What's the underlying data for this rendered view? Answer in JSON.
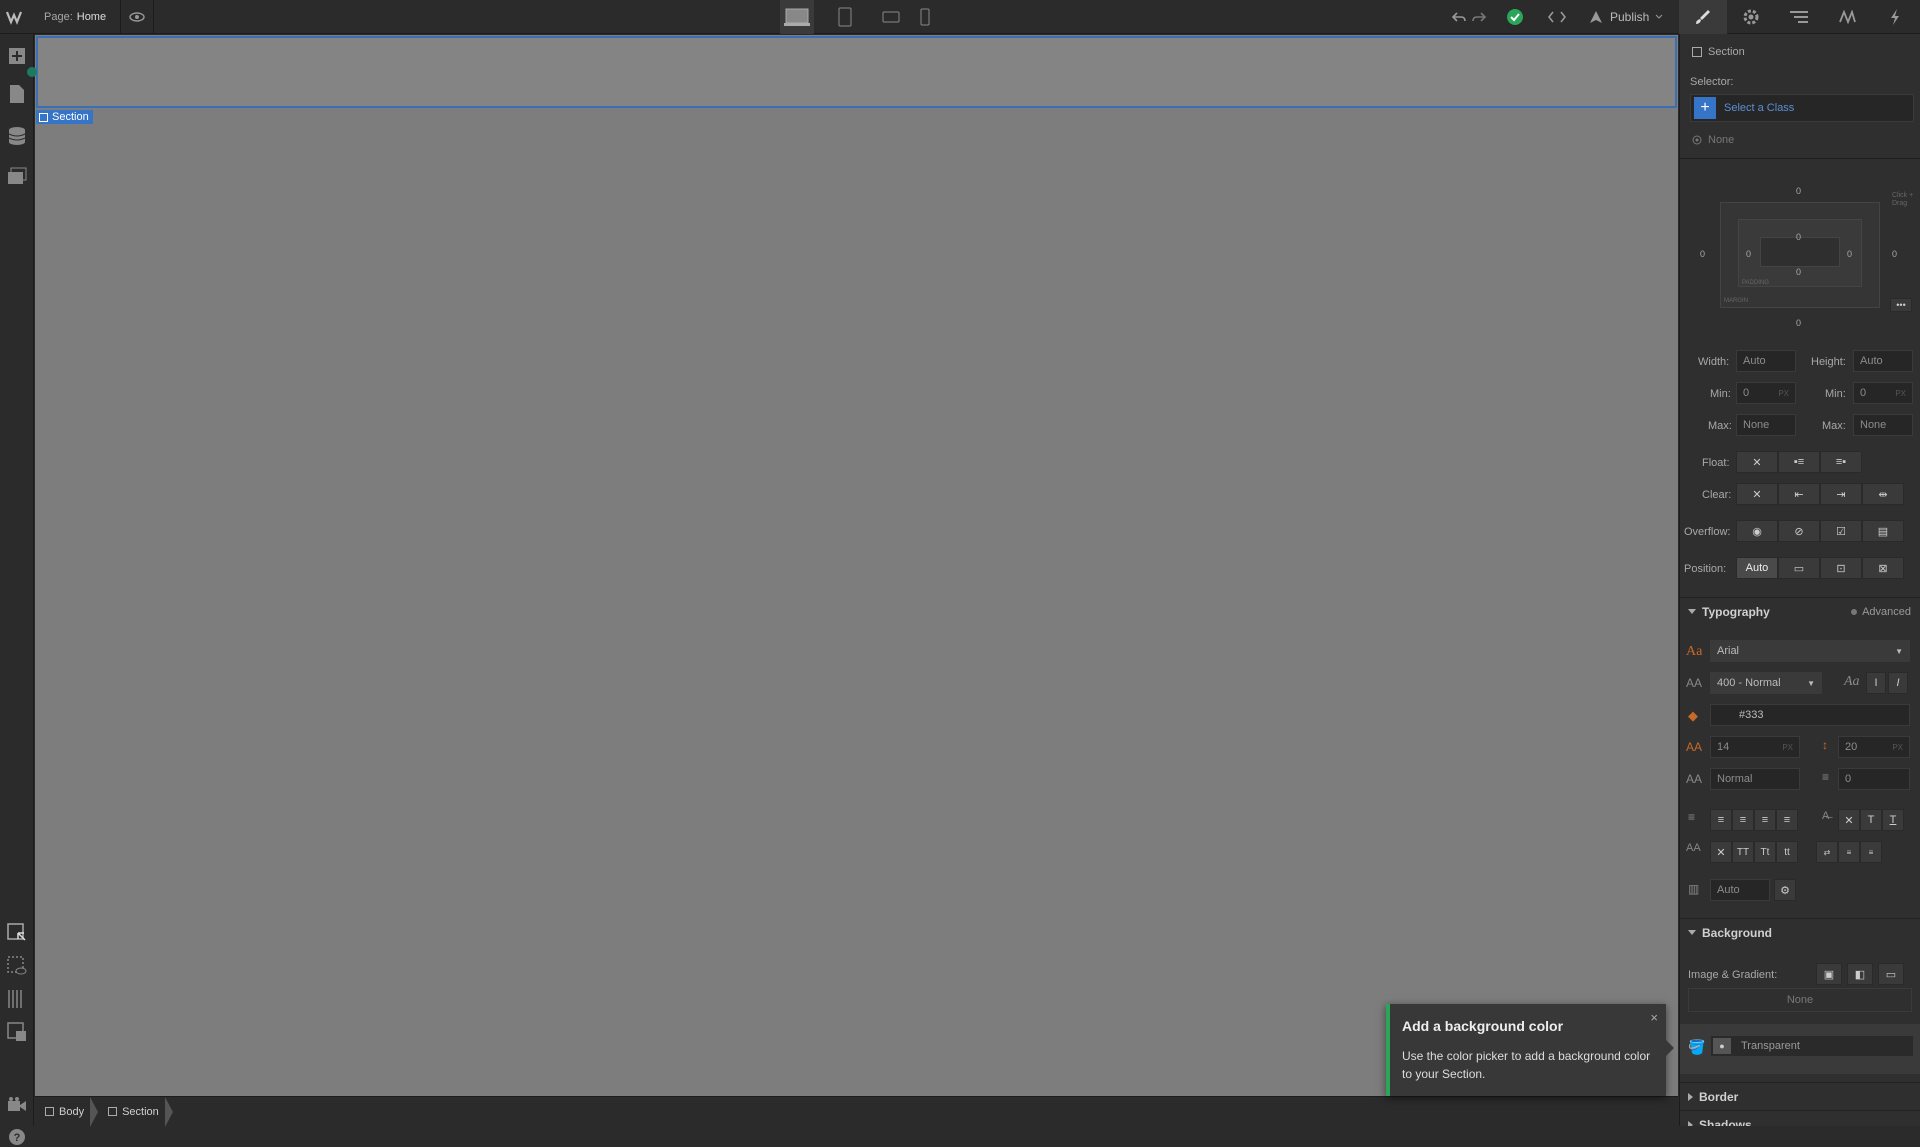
{
  "topbar": {
    "page_label": "Page:",
    "page_name": "Home",
    "publish_label": "Publish"
  },
  "canvas": {
    "section_tag": "Section"
  },
  "breadcrumbs": [
    "Body",
    "Section"
  ],
  "panel": {
    "element_name": "Section",
    "selector_label": "Selector:",
    "select_class_placeholder": "Select a Class",
    "state_label": "None",
    "spacing": {
      "margin_top": "0",
      "margin_left": "0",
      "margin_right": "0",
      "padding_top": "0",
      "padding_left": "0",
      "padding_right": "0",
      "padding_bottom": "0",
      "margin_bottom": "0",
      "padding_caption": "PADDING",
      "margin_caption": "MARGIN",
      "hint": "Click + Drag"
    },
    "size": {
      "width_label": "Width:",
      "width_value": "Auto",
      "height_label": "Height:",
      "height_value": "Auto",
      "min_label": "Min:",
      "min_w": "0",
      "min_h": "0",
      "unit": "PX",
      "max_label": "Max:",
      "max_w": "None",
      "max_h": "None"
    },
    "float_label": "Float:",
    "clear_label": "Clear:",
    "overflow_label": "Overflow:",
    "position_label": "Position:",
    "position_value": "Auto",
    "typography": {
      "title": "Typography",
      "advanced": "Advanced",
      "font": "Arial",
      "weight": "400 - Normal",
      "color": "#333",
      "size": "14",
      "size_unit": "PX",
      "line_height": "20",
      "lh_unit": "PX",
      "letter_spacing": "Normal",
      "text_indent": "0",
      "columns": "Auto"
    },
    "background": {
      "title": "Background",
      "image_label": "Image & Gradient:",
      "image_value": "None",
      "color_value": "Transparent"
    },
    "border_title": "Border",
    "shadows_title": "Shadows"
  },
  "toast": {
    "title": "Add a background color",
    "body": "Use the color picker to add a background color to your Section.",
    "close": "×"
  },
  "colors": {
    "accent": "#3574c6",
    "success": "#2aa55a",
    "canvas": "#7d7d7d",
    "panel": "#2f2f2f"
  }
}
